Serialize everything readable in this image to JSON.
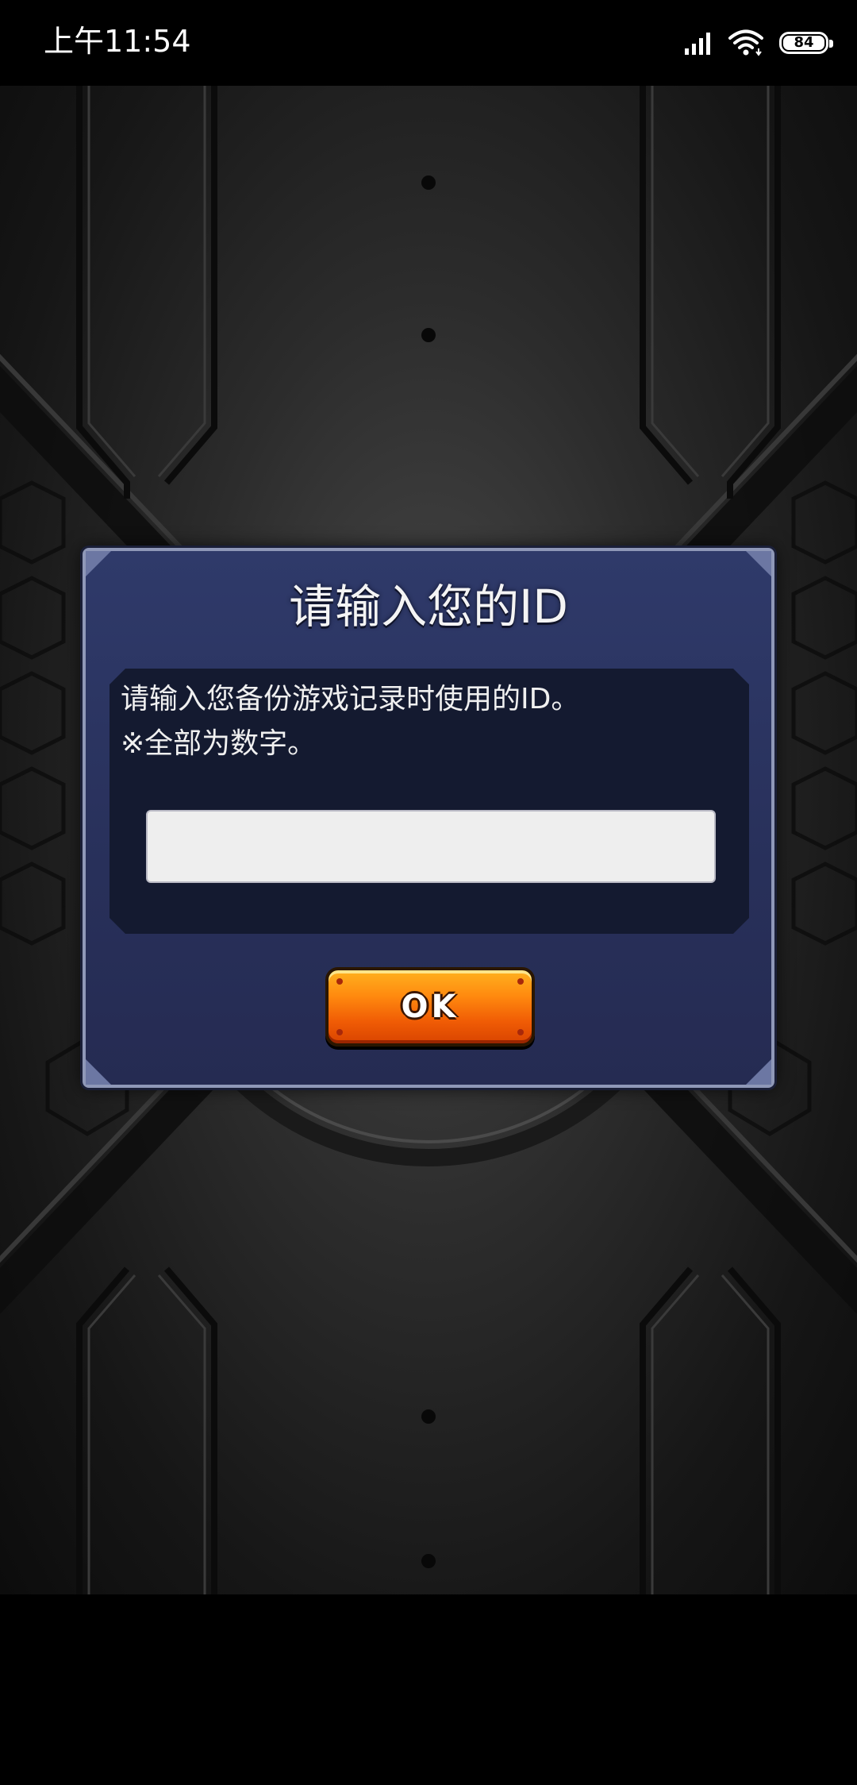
{
  "status_bar": {
    "time": "上午11:54",
    "battery_level": "84",
    "icons": [
      "signal-icon",
      "wifi-icon",
      "battery-icon"
    ]
  },
  "dialog": {
    "title": "请输入您的ID",
    "message_line1": "请输入您备份游戏记录时使用的ID。",
    "message_line2": "※全部为数字。",
    "id_input_value": "",
    "ok_label": "OK"
  },
  "colors": {
    "dialog_bg": "#2b3462",
    "dialog_border": "#8f98b8",
    "panel_bg": "#141a30",
    "button_orange": "#f06a08"
  }
}
